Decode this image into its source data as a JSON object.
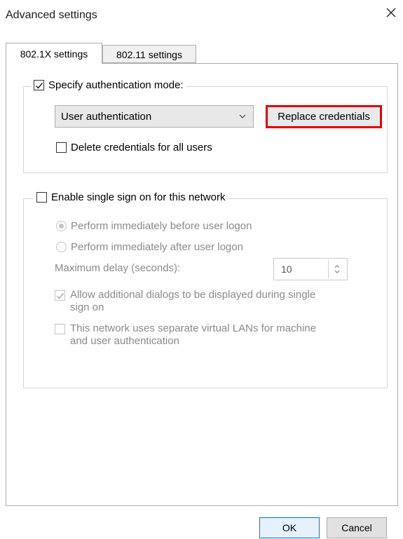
{
  "window": {
    "title": "Advanced settings",
    "close_icon": "close-icon"
  },
  "tabs": [
    {
      "label": "802.1X settings",
      "active": true
    },
    {
      "label": "802.11 settings",
      "active": false
    }
  ],
  "auth_group": {
    "checkbox_label": "Specify authentication mode:",
    "checked": true,
    "mode_select_value": "User authentication",
    "replace_button_label": "Replace credentials",
    "highlight_color": "#e00000",
    "delete_checkbox_label": "Delete credentials for all users",
    "delete_checked": false
  },
  "sso_group": {
    "checkbox_label": "Enable single sign on for this network",
    "checked": false,
    "radio_before_label": "Perform immediately before user logon",
    "radio_before_selected": true,
    "radio_after_label": "Perform immediately after user logon",
    "radio_after_selected": false,
    "delay_label": "Maximum delay (seconds):",
    "delay_value": "10",
    "allow_dialogs_label_line1": "Allow additional dialogs to be displayed during single",
    "allow_dialogs_label_line2": "sign on",
    "allow_dialogs_checked": true,
    "vlan_label_line1": "This network uses separate virtual LANs for machine",
    "vlan_label_line2": "and user authentication",
    "vlan_checked": false
  },
  "footer": {
    "ok_label": "OK",
    "cancel_label": "Cancel"
  }
}
